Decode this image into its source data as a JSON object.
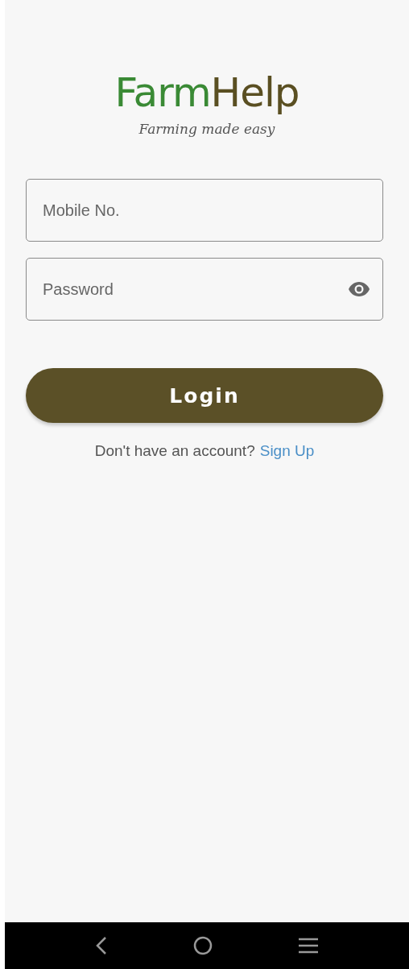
{
  "logo": {
    "parts": [
      {
        "text": "Farm",
        "color": "#3a8a35"
      },
      {
        "text": "Help",
        "color": "#5a4f22"
      }
    ],
    "tagline": "Farming made easy"
  },
  "fields": [
    {
      "kind": "text",
      "placeholder": "Mobile No."
    },
    {
      "kind": "password",
      "placeholder": "Password"
    }
  ],
  "login_button": "Login",
  "signup": {
    "prompt": "Don't have an account?",
    "link": "Sign Up"
  }
}
